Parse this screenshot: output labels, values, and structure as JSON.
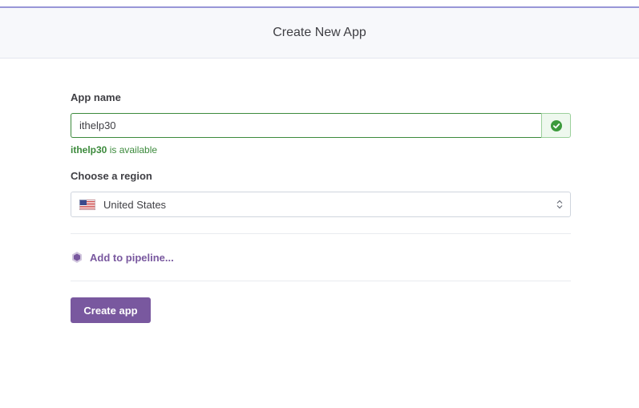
{
  "header": {
    "title": "Create New App"
  },
  "form": {
    "app_name_label": "App name",
    "app_name_value": "ithelp30",
    "availability_name": "ithelp30",
    "availability_suffix": " is available",
    "region_label": "Choose a region",
    "region_value": "United States",
    "region_flag_icon": "us-flag-icon",
    "pipeline_label": "Add to pipeline...",
    "pipeline_icon": "pipeline-hexagon-icon",
    "create_button_label": "Create app"
  },
  "colors": {
    "accent": "#79589f",
    "success": "#3c8a3c",
    "top_bar": "#9896d7"
  }
}
